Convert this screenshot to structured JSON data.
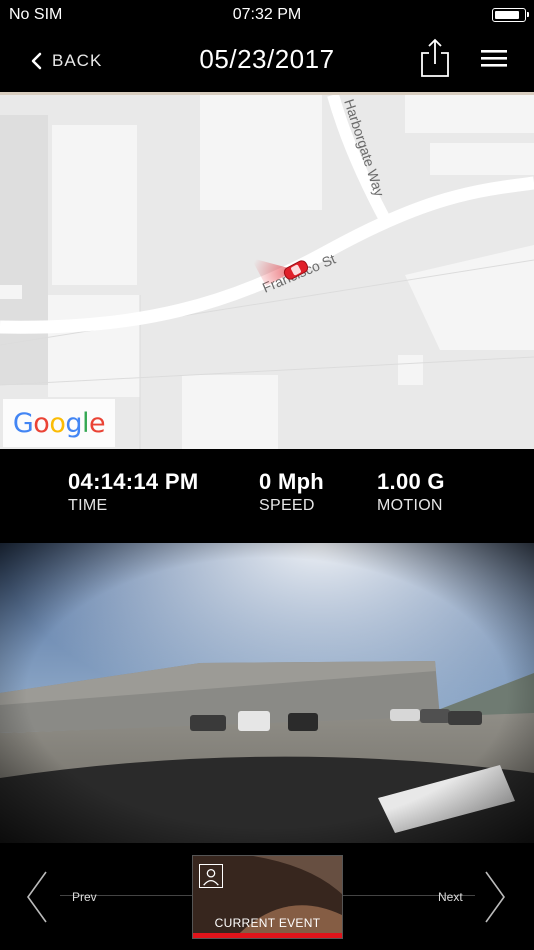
{
  "status_bar": {
    "carrier": "No SIM",
    "time": "07:32 PM",
    "battery_level": 0.85
  },
  "nav": {
    "back_label": "BACK",
    "title": "05/23/2017",
    "share_icon": "share-icon",
    "menu_icon": "hamburger-menu-icon"
  },
  "map": {
    "streets": [
      "Harborgate Way",
      "Francisco St"
    ],
    "attribution": "Google",
    "marker_icon": "car-marker-icon",
    "marker_color": "#e0202a"
  },
  "telemetry": {
    "time": {
      "value": "04:14:14 PM",
      "label": "TIME"
    },
    "speed": {
      "value": "0 Mph",
      "label": "SPEED"
    },
    "motion": {
      "value": "1.00 G",
      "label": "MOTION"
    }
  },
  "event_bar": {
    "prev_label": "Prev",
    "next_label": "Next",
    "current_label": "CURRENT EVENT",
    "accent_color": "#e0141b"
  }
}
